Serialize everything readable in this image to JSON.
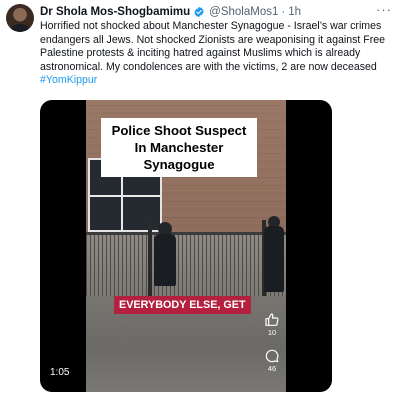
{
  "tweet": {
    "author_name": "Dr Shola Mos-Shogbamimu",
    "handle": "@SholaMos1",
    "separator": "·",
    "time": "1h",
    "more_label": "···",
    "text": "Horrified not shocked about Manchester Synagogue - Israel’s war crimes endangers all Jews. Not shocked Zionists are weaponising it against Free Palestine protests & inciting hatred against Muslims which is already astronomical. My condolences are with the victims, 2 are now deceased",
    "hashtag": "#YomKippur",
    "verified_color": "#1d9bf0",
    "link_color": "#1d9bf0"
  },
  "video": {
    "headline": "Police Shoot Suspect In Manchester Synagogue",
    "subtitle": "EVERYBODY ELSE, GET",
    "subtitle_color": "#b3213f",
    "duration": "1:05",
    "like_count": "10",
    "comment_count": "46"
  }
}
